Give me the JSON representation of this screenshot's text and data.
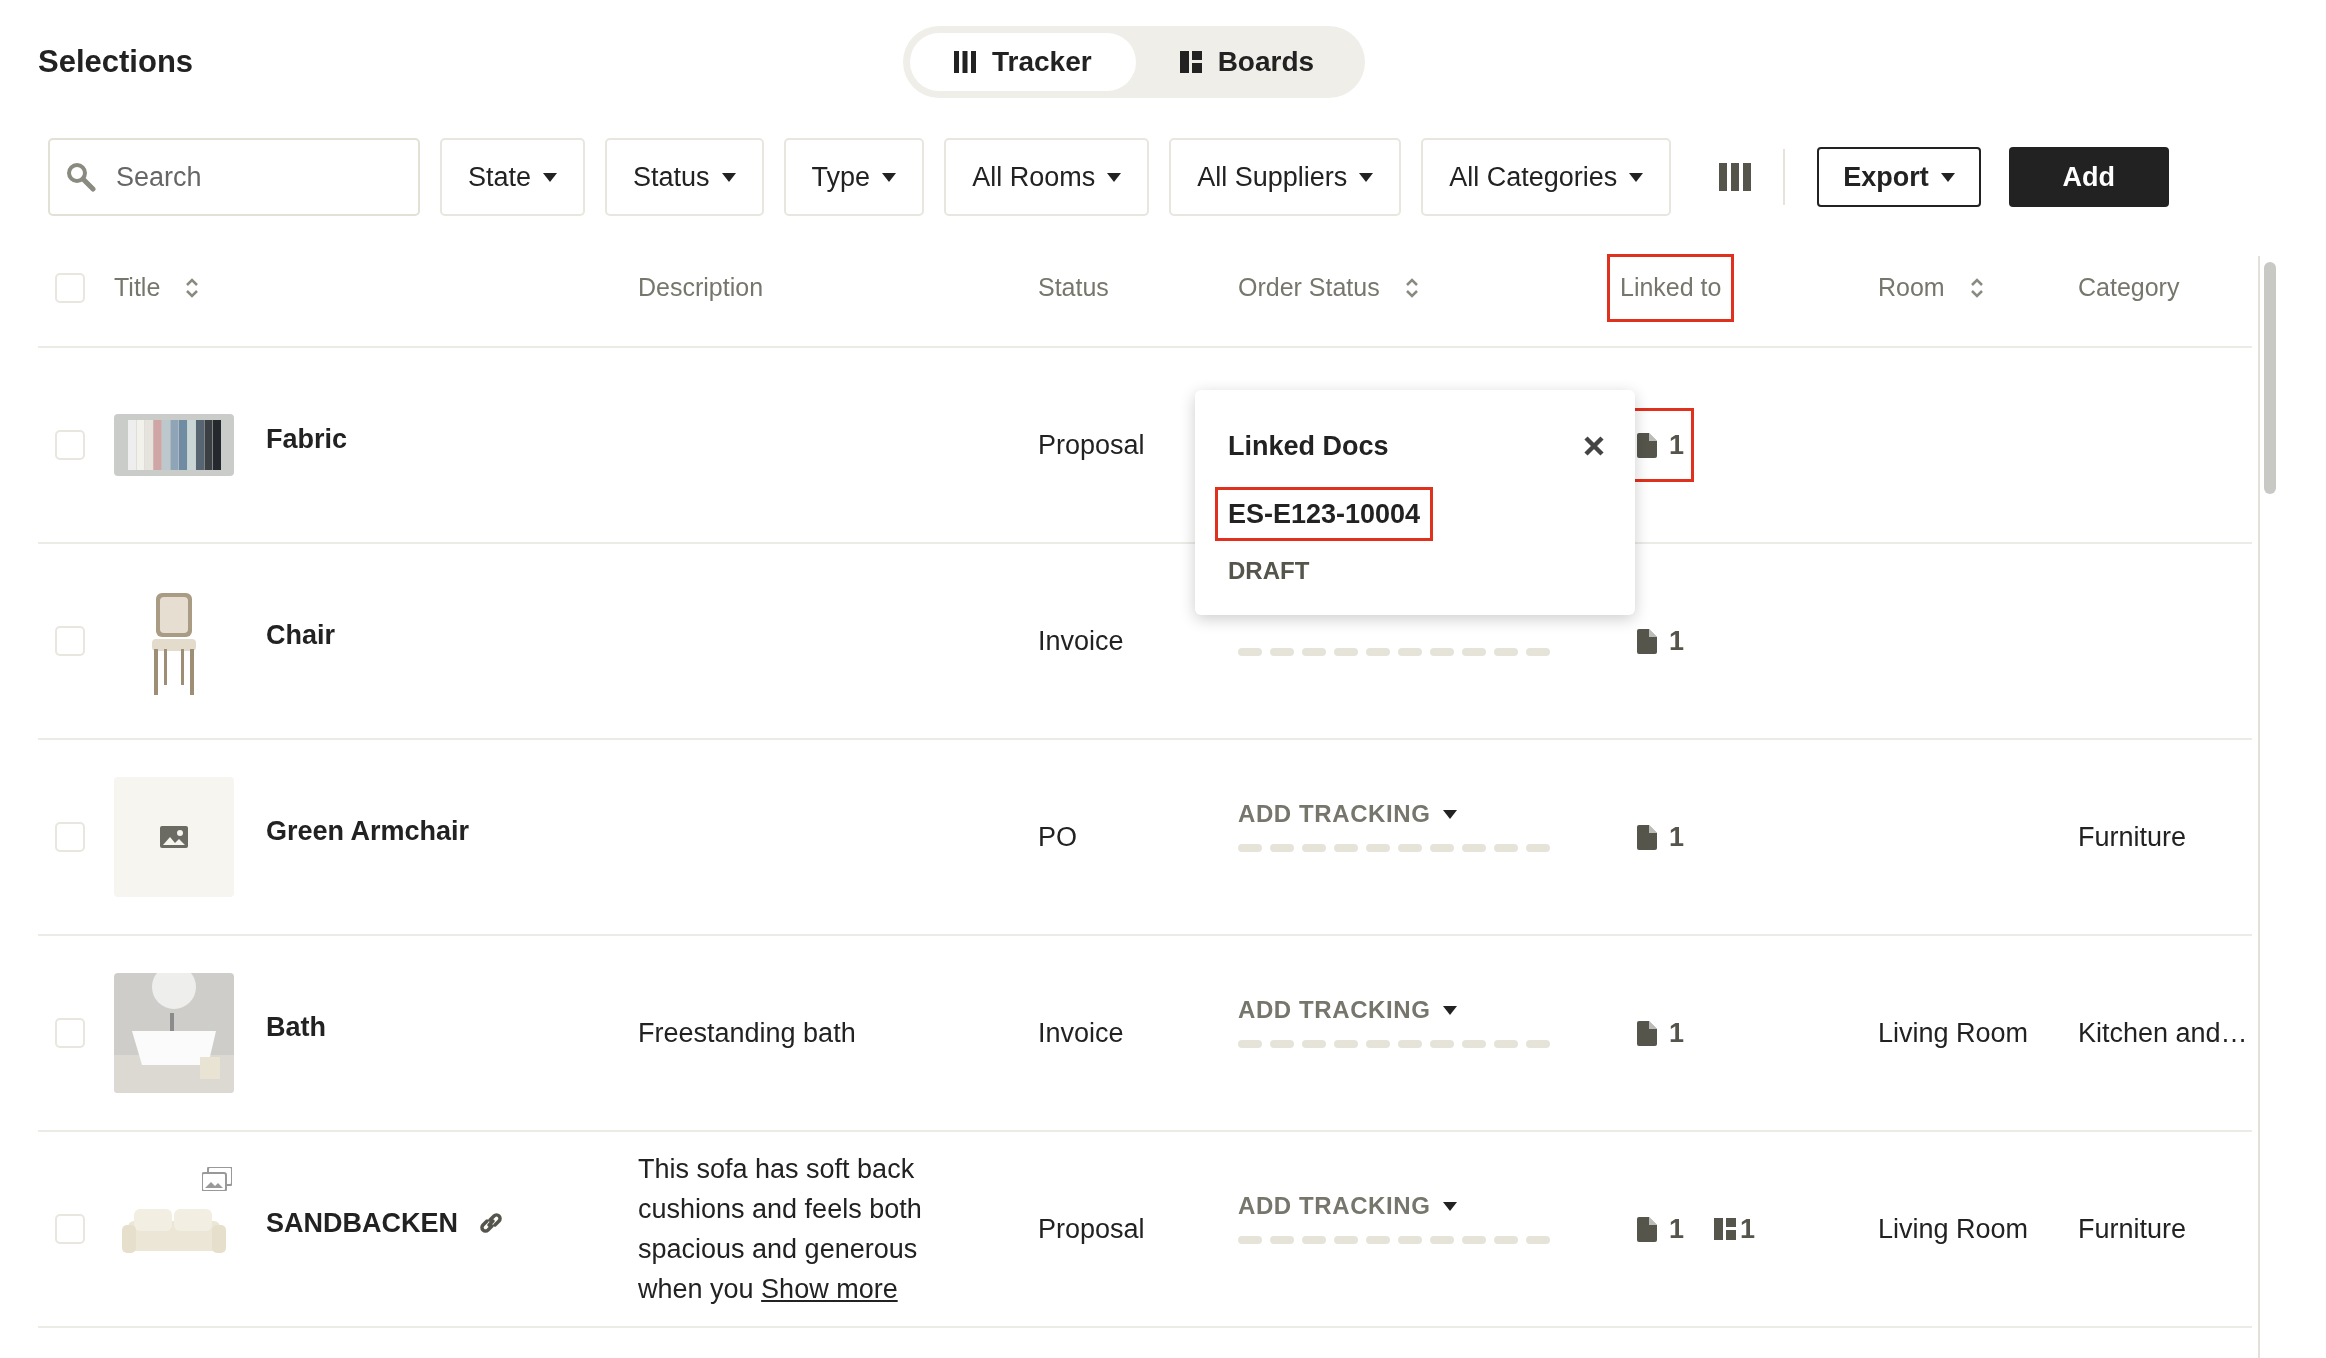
{
  "page": {
    "title": "Selections"
  },
  "view_toggle": [
    {
      "label": "Tracker",
      "kind": "columns",
      "selected": true
    },
    {
      "label": "Boards",
      "kind": "boards",
      "selected": false
    }
  ],
  "search": {
    "placeholder": "Search"
  },
  "filters": [
    "State",
    "Status",
    "Type",
    "All Rooms",
    "All Suppliers",
    "All Categories"
  ],
  "actions": {
    "export": "Export",
    "add": "Add"
  },
  "table": {
    "header_checked": false,
    "columns": [
      {
        "label": "Title",
        "sortable": true,
        "highlighted": false
      },
      {
        "label": "Description",
        "sortable": false,
        "highlighted": false
      },
      {
        "label": "Status",
        "sortable": false,
        "highlighted": false
      },
      {
        "label": "Order Status",
        "sortable": true,
        "highlighted": false
      },
      {
        "label": "Linked to",
        "sortable": false,
        "highlighted": true
      },
      {
        "label": "Room",
        "sortable": true,
        "highlighted": false
      },
      {
        "label": "Category",
        "sortable": false,
        "highlighted": false
      }
    ],
    "rows": [
      {
        "checked": false,
        "kind": "picture",
        "title": "Fabric",
        "has_link": false,
        "status": "Proposal",
        "tracking_bar": false,
        "docs": "1",
        "docs_highlighted": true
      },
      {
        "checked": false,
        "kind": "picture",
        "title": "Chair",
        "has_link": false,
        "status": "Invoice",
        "tracking_bar": true,
        "docs": "1",
        "docs_highlighted": false
      },
      {
        "checked": false,
        "kind": "placeholder",
        "title": "Green Armchair",
        "has_link": false,
        "status": "PO",
        "tracking": "ADD TRACKING",
        "tracking_bar": true,
        "docs": "1",
        "docs_highlighted": false,
        "category": "Furniture"
      },
      {
        "checked": false,
        "kind": "picture",
        "title": "Bath",
        "has_link": false,
        "description": "Freestanding bath",
        "status": "Invoice",
        "tracking": "ADD TRACKING",
        "tracking_bar": true,
        "docs": "1",
        "docs_highlighted": false,
        "room": "Living Room",
        "category": "Kitchen and…"
      },
      {
        "checked": false,
        "kind": "gallery",
        "title": "SANDBACKEN",
        "has_link": true,
        "description": "This sofa has soft back cushions and feels both spacious and generous when you",
        "show_more": "Show more",
        "status": "Proposal",
        "tracking": "ADD TRACKING",
        "tracking_bar": true,
        "docs": "1",
        "docs_highlighted": false,
        "boards": "1",
        "room": "Living Room",
        "category": "Furniture"
      }
    ]
  },
  "popup": {
    "title": "Linked Docs",
    "items": [
      {
        "code": "ES-E123-10004",
        "status": "DRAFT",
        "highlighted": true
      }
    ]
  }
}
